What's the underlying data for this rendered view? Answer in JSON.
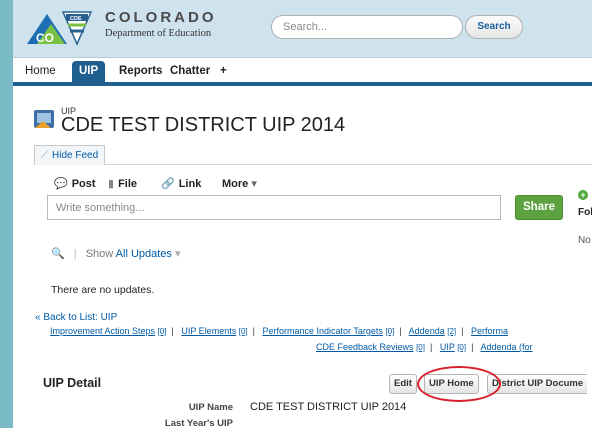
{
  "header": {
    "logo_text": "CO",
    "logo_badge": "CDE",
    "brand_title": "COLORADO",
    "brand_sub": "Department of Education",
    "search_placeholder": "Search...",
    "search_button": "Search"
  },
  "tabs": {
    "home": "Home",
    "uip": "UIP",
    "reports": "Reports",
    "chatter": "Chatter",
    "plus": "+"
  },
  "page": {
    "object_type": "UIP",
    "title": "CDE TEST DISTRICT UIP 2014",
    "hide_feed": "Hide Feed"
  },
  "publisher": {
    "post": "Post",
    "file": "File",
    "link": "Link",
    "more": "More",
    "placeholder": "Write something...",
    "share": "Share"
  },
  "sidebar": {
    "follow": "Fol",
    "no": "No"
  },
  "feed": {
    "show_label": "Show",
    "show_value": "All Updates",
    "no_updates": "There are no updates."
  },
  "related": {
    "back": "« Back to List: UIP",
    "row1": [
      {
        "label": "Improvement Action Steps",
        "count": "[0]"
      },
      {
        "label": "UIP Elements",
        "count": "[0]"
      },
      {
        "label": "Performance Indicator Targets",
        "count": "[0]"
      },
      {
        "label": "Addenda",
        "count": "[2]"
      },
      {
        "label": "Performa",
        "count": ""
      }
    ],
    "row2": [
      {
        "label": "CDE Feedback Reviews",
        "count": "[0]"
      },
      {
        "label": "UIP",
        "count": "[0]"
      },
      {
        "label": "Addenda (for",
        "count": ""
      }
    ]
  },
  "detail": {
    "title": "UIP Detail",
    "edit": "Edit",
    "uip_home": "UIP Home",
    "district_docs": "District UIP Docume",
    "fields": [
      {
        "label": "UIP Name",
        "value": "CDE TEST DISTRICT UIP 2014"
      },
      {
        "label": "Last Year's UIP",
        "value": ""
      }
    ]
  },
  "colors": {
    "accent": "#1f5f8f",
    "link": "#015ba7",
    "share_green": "#5ca240",
    "highlight_red": "#d9202a",
    "outer_bg": "#7bbbc7"
  }
}
